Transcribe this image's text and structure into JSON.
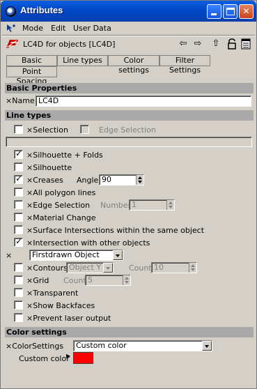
{
  "window": {
    "title": "Attributes"
  },
  "menu": {
    "items": [
      "Mode",
      "Edit",
      "User Data"
    ]
  },
  "header": {
    "title": "LC4D for objects [LC4D]",
    "icons": [
      "arrow-left-icon",
      "arrow-right-icon",
      "arrow-up-icon",
      "lock-icon",
      "panel-icon"
    ]
  },
  "tabs": [
    "Basic",
    "Line types",
    "Color settings",
    "Filter Settings",
    "Point Spacing"
  ],
  "basic": {
    "section_title": "Basic Properties",
    "name_label": "Name",
    "name_value": "LC4D"
  },
  "line_types": {
    "section_title": "Line types",
    "selection_label": "Selection",
    "edge_selection_top_label": "Edge Selection",
    "silhouette_folds_label": "Silhouette + Folds",
    "silhouette_label": "Silhouette",
    "creases_label": "Creases",
    "angle_label": "Angle",
    "angle_value": "90",
    "all_polygon_lines_label": "All polygon lines",
    "edge_selection_label": "Edge Selection",
    "number_label": "Number",
    "number_value": "1",
    "material_change_label": "Material Change",
    "surface_intersections_label": "Surface Intersections within the same object",
    "intersection_other_label": "Intersection with other objects",
    "intersection_mode_value": "Firstdrawn Object",
    "contours_label": "Contours",
    "contours_axis_value": "Object Y",
    "count_label": "Count",
    "contours_count_value": "10",
    "grid_label": "Grid",
    "grid_count_value": "5",
    "transparent_label": "Transparent",
    "show_backfaces_label": "Show Backfaces",
    "prevent_laser_label": "Prevent laser output",
    "checked": {
      "selection": false,
      "edge_selection_top": false,
      "silhouette_folds": true,
      "silhouette": false,
      "creases": true,
      "all_polygon_lines": false,
      "edge_selection": false,
      "material_change": false,
      "surface_intersections": false,
      "intersection_other": true,
      "contours": false,
      "grid": false,
      "transparent": false,
      "show_backfaces": false,
      "prevent_laser": false
    }
  },
  "color_settings": {
    "section_title": "Color settings",
    "color_settings_label": "ColorSettings",
    "color_settings_value": "Custom color",
    "custom_color_label": "Custom color",
    "custom_color": "#ff0000"
  },
  "x_mark": "×",
  "tick": "✓"
}
